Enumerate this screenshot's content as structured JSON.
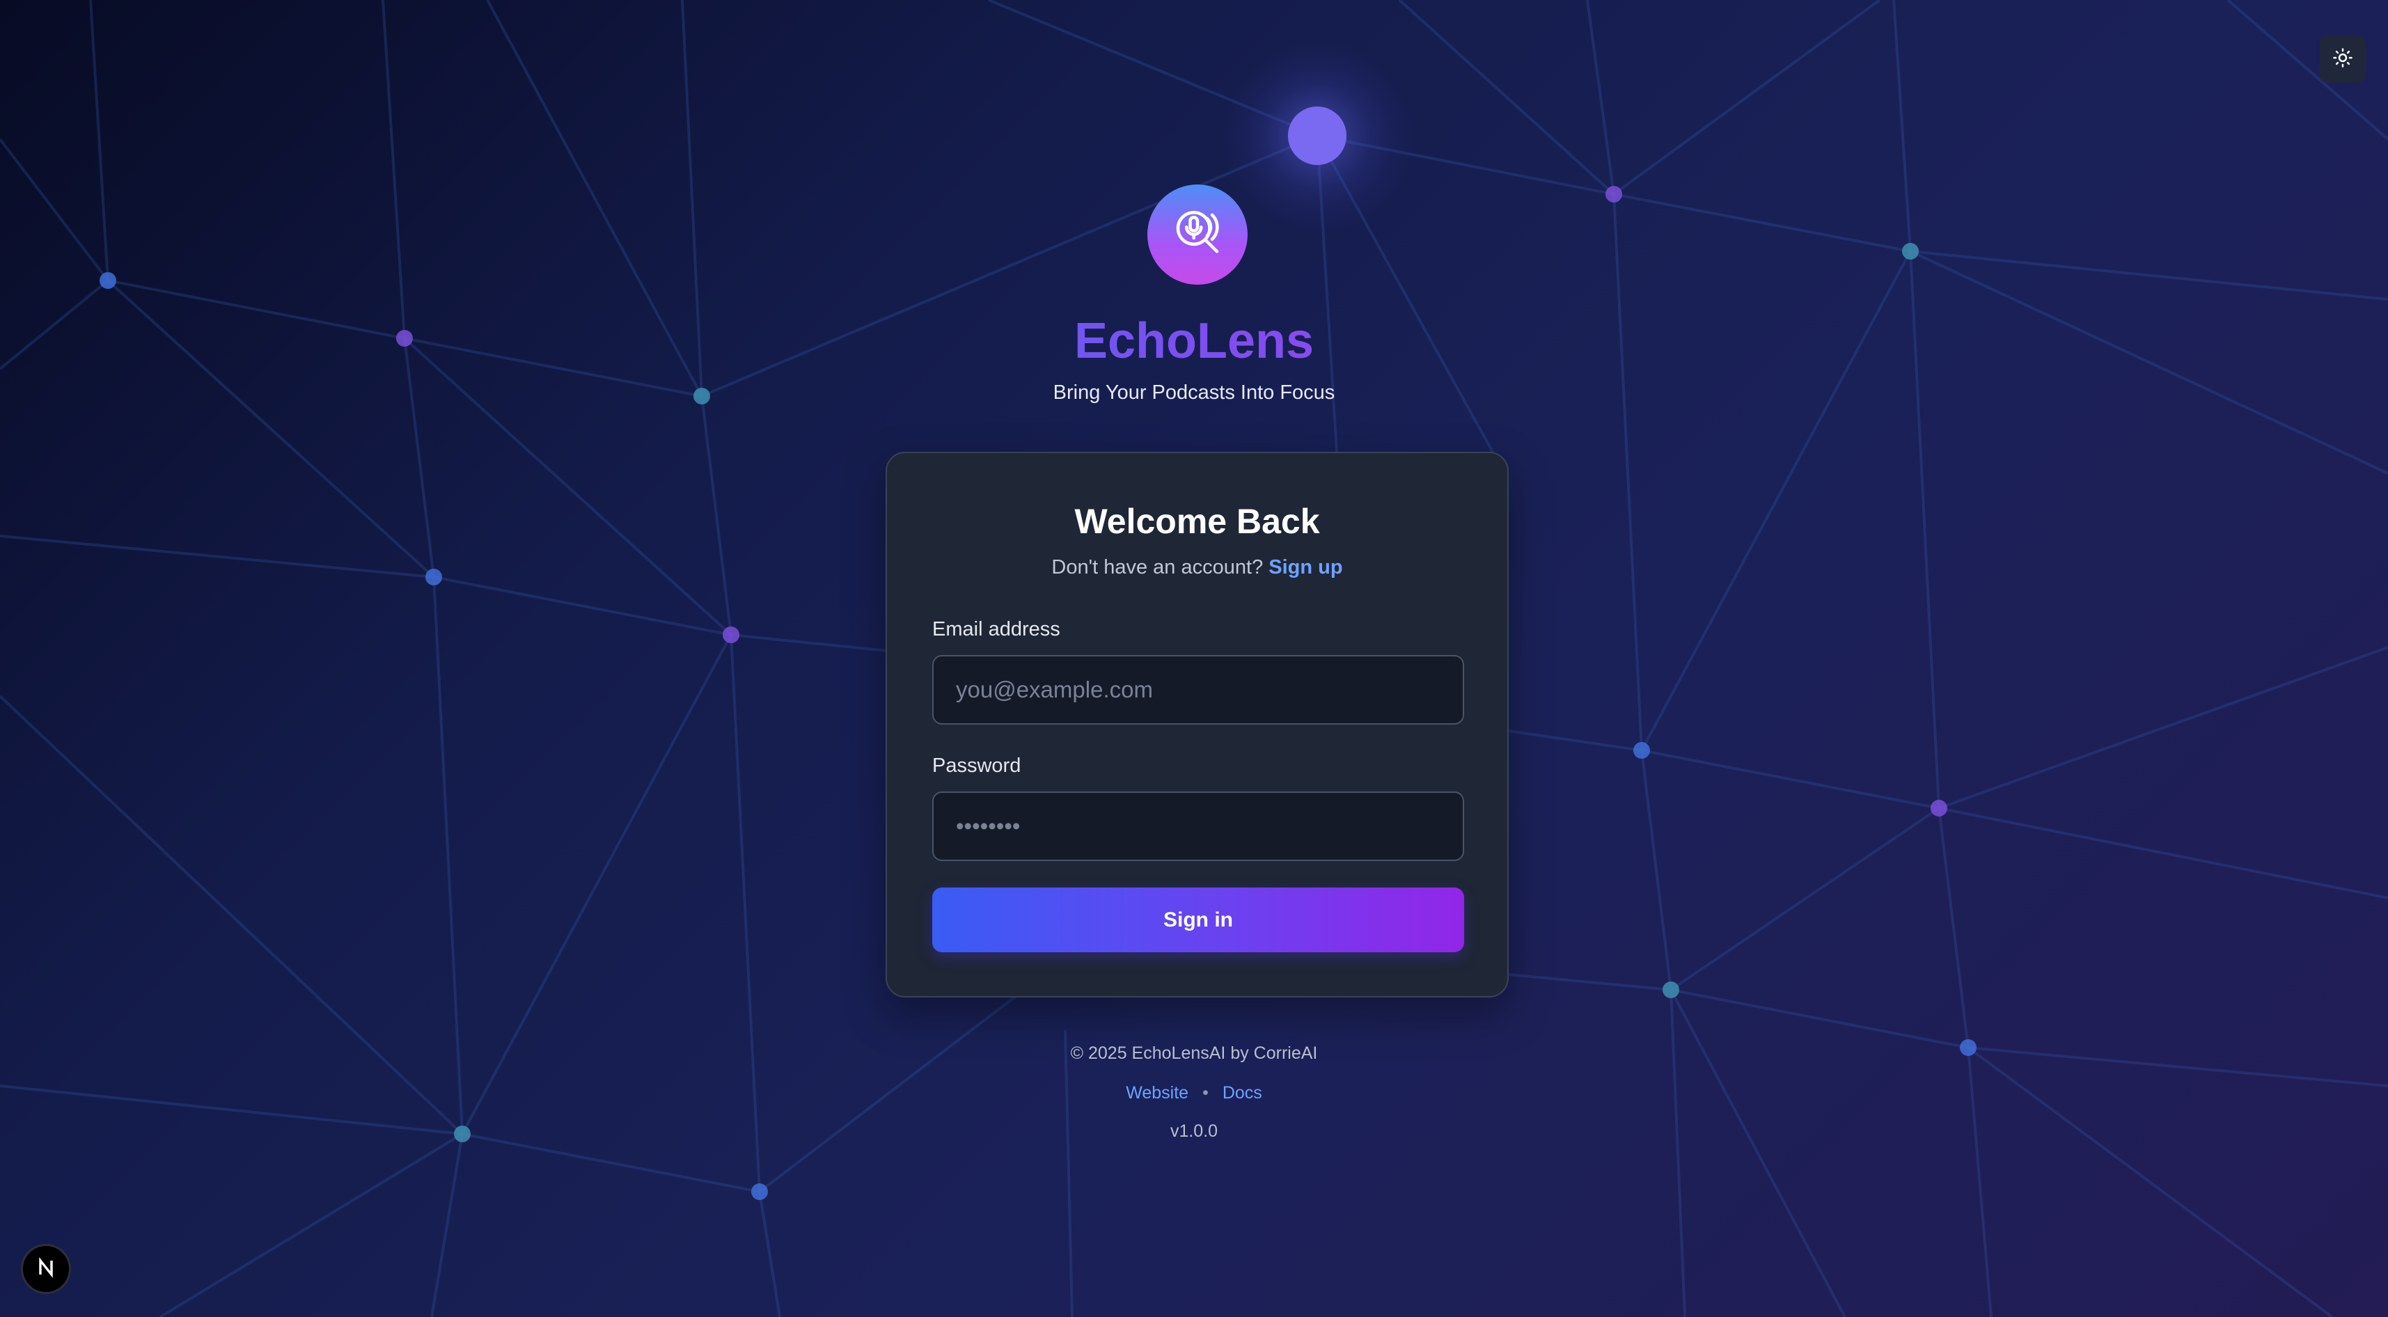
{
  "theme_toggle": {
    "icon": "sun-icon"
  },
  "brand": {
    "logo_icon": "podcast-search-icon",
    "title": "EchoLens",
    "tagline": "Bring Your Podcasts Into Focus"
  },
  "login_card": {
    "title": "Welcome Back",
    "signup_prompt": "Don't have an account?",
    "signup_link": "Sign up",
    "email": {
      "label": "Email address",
      "placeholder": "you@example.com",
      "value": ""
    },
    "password": {
      "label": "Password",
      "placeholder": "••••••••",
      "value": ""
    },
    "submit_label": "Sign in"
  },
  "footer": {
    "copyright": "© 2025 EchoLensAI by CorrieAI",
    "links": [
      {
        "label": "Website"
      },
      {
        "label": "Docs"
      }
    ],
    "separator": "•",
    "version": "v1.0.0"
  },
  "dev_badge": {
    "letter": "N",
    "icon": "nextjs-icon"
  },
  "colors": {
    "background_start": "#070b24",
    "background_end": "#231c55",
    "accent_blue": "#3a5cf5",
    "accent_purple": "#9226e8",
    "link": "#6ea2ff",
    "card_bg": "#1f2636",
    "node_blue": "#3f6fd8",
    "node_teal": "#3e8fb0",
    "node_purple": "#7a4fd8"
  }
}
